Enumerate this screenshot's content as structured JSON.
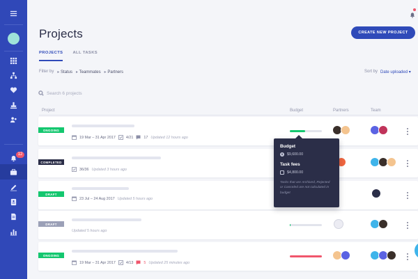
{
  "sidebar": {
    "icons": [
      "menu-icon",
      "grid-icon",
      "hierarchy-icon",
      "heart-icon",
      "stamp-icon",
      "users-icon",
      "bell-icon",
      "briefcase-icon",
      "pen-icon",
      "contact-card-icon",
      "document-icon",
      "bar-chart-icon"
    ],
    "notification_count": "12",
    "accent": "#3048b8"
  },
  "header": {
    "title": "Projects",
    "create_button": "CREATE NEW PROJECT"
  },
  "tabs": [
    {
      "label": "PROJECTS",
      "active": true
    },
    {
      "label": "ALL TASKS",
      "active": false
    }
  ],
  "filter": {
    "label": "Filter by",
    "options": [
      "Status",
      "Teammates",
      "Partners"
    ]
  },
  "sort": {
    "label": "Sort by",
    "value": "Date uploaded"
  },
  "search": {
    "placeholder": "Search 6 projects"
  },
  "columns": {
    "project": "Project",
    "budget": "Budget",
    "partners": "Partners",
    "team": "Team"
  },
  "projects": [
    {
      "status": "ONGOING",
      "dates": "19 Mar – 31 Apr 2017",
      "tasks": "4/21",
      "comments": "17",
      "updated": "Updated 12 hours ago",
      "budget_fraction": 0.48,
      "budget_color": "#14c76f"
    },
    {
      "status": "COMPLETED",
      "tasks": "36/36",
      "updated": "Updated 3 hours ago"
    },
    {
      "status": "DRAFT",
      "dates": "23 Jul – 24 Aug 2017",
      "updated": "Updated 5 hours ago"
    },
    {
      "status": "DRAFT",
      "updated": "Updated 5 hours ago",
      "budget_fraction": 0.03,
      "budget_color": "#14c76f"
    },
    {
      "status": "ONGOING",
      "dates": "19 Mar – 31 Apr 2017",
      "tasks": "4/13",
      "comments": "5",
      "updated": "Updated 25 minutes ago",
      "budget_fraction": 1.0,
      "budget_color": "#f0566c"
    }
  ],
  "tooltip": {
    "budget_title": "Budget",
    "budget_value": "$9,600.00",
    "fees_title": "Task fees",
    "fees_value": "$4,800.00",
    "note": "Tasks that are Archived, Rejected or Canceled are not calculated in budget"
  }
}
